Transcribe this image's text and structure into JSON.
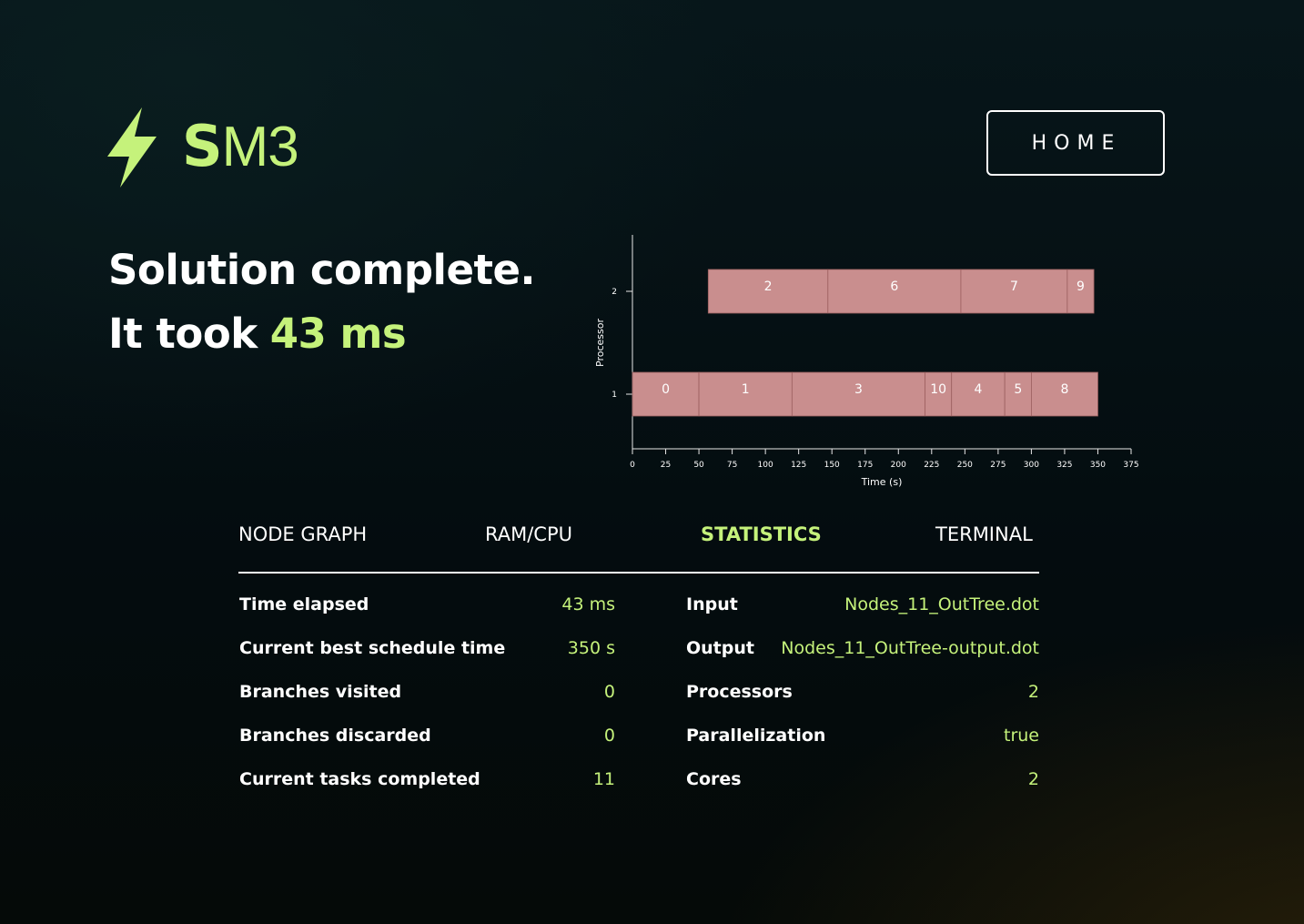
{
  "logo": {
    "text_s": "S",
    "text_rest": "M3",
    "icon": "lightning-bolt-icon"
  },
  "header": {
    "home_label": "HOME"
  },
  "headline": {
    "line1": "Solution complete.",
    "line2_prefix": "It took",
    "duration": "43 ms"
  },
  "colors": {
    "accent": "#c5f27b",
    "task_fill": "#c98e8e",
    "task_stroke": "#9c5f5f",
    "text": "#ffffff"
  },
  "chart_data": {
    "type": "gantt",
    "xlabel": "Time (s)",
    "ylabel": "Processor",
    "xlim": [
      0,
      375
    ],
    "x_ticks": [
      0,
      25,
      50,
      75,
      100,
      125,
      150,
      175,
      200,
      225,
      250,
      275,
      300,
      325,
      350,
      375
    ],
    "y_categories": [
      "1",
      "2"
    ],
    "tasks": [
      {
        "label": "0",
        "processor": "1",
        "start": 0,
        "end": 50
      },
      {
        "label": "1",
        "processor": "1",
        "start": 50,
        "end": 120
      },
      {
        "label": "3",
        "processor": "1",
        "start": 120,
        "end": 220
      },
      {
        "label": "10",
        "processor": "1",
        "start": 220,
        "end": 240
      },
      {
        "label": "4",
        "processor": "1",
        "start": 240,
        "end": 280
      },
      {
        "label": "5",
        "processor": "1",
        "start": 280,
        "end": 300
      },
      {
        "label": "8",
        "processor": "1",
        "start": 300,
        "end": 350
      },
      {
        "label": "2",
        "processor": "2",
        "start": 57,
        "end": 147
      },
      {
        "label": "6",
        "processor": "2",
        "start": 147,
        "end": 247
      },
      {
        "label": "7",
        "processor": "2",
        "start": 247,
        "end": 327
      },
      {
        "label": "9",
        "processor": "2",
        "start": 327,
        "end": 347
      }
    ]
  },
  "tabs": [
    {
      "label": "NODE GRAPH",
      "active": false
    },
    {
      "label": "RAM/CPU",
      "active": false
    },
    {
      "label": "STATISTICS",
      "active": true
    },
    {
      "label": "TERMINAL",
      "active": false
    }
  ],
  "stats_left": [
    {
      "label": "Time elapsed",
      "value": "43 ms"
    },
    {
      "label": "Current best schedule time",
      "value": "350 s"
    },
    {
      "label": "Branches visited",
      "value": "0"
    },
    {
      "label": "Branches discarded",
      "value": "0"
    },
    {
      "label": "Current tasks completed",
      "value": "11"
    }
  ],
  "stats_right": [
    {
      "label": "Input",
      "value": "Nodes_11_OutTree.dot"
    },
    {
      "label": "Output",
      "value": "Nodes_11_OutTree-output.dot"
    },
    {
      "label": "Processors",
      "value": "2"
    },
    {
      "label": "Parallelization",
      "value": "true"
    },
    {
      "label": "Cores",
      "value": "2"
    }
  ]
}
